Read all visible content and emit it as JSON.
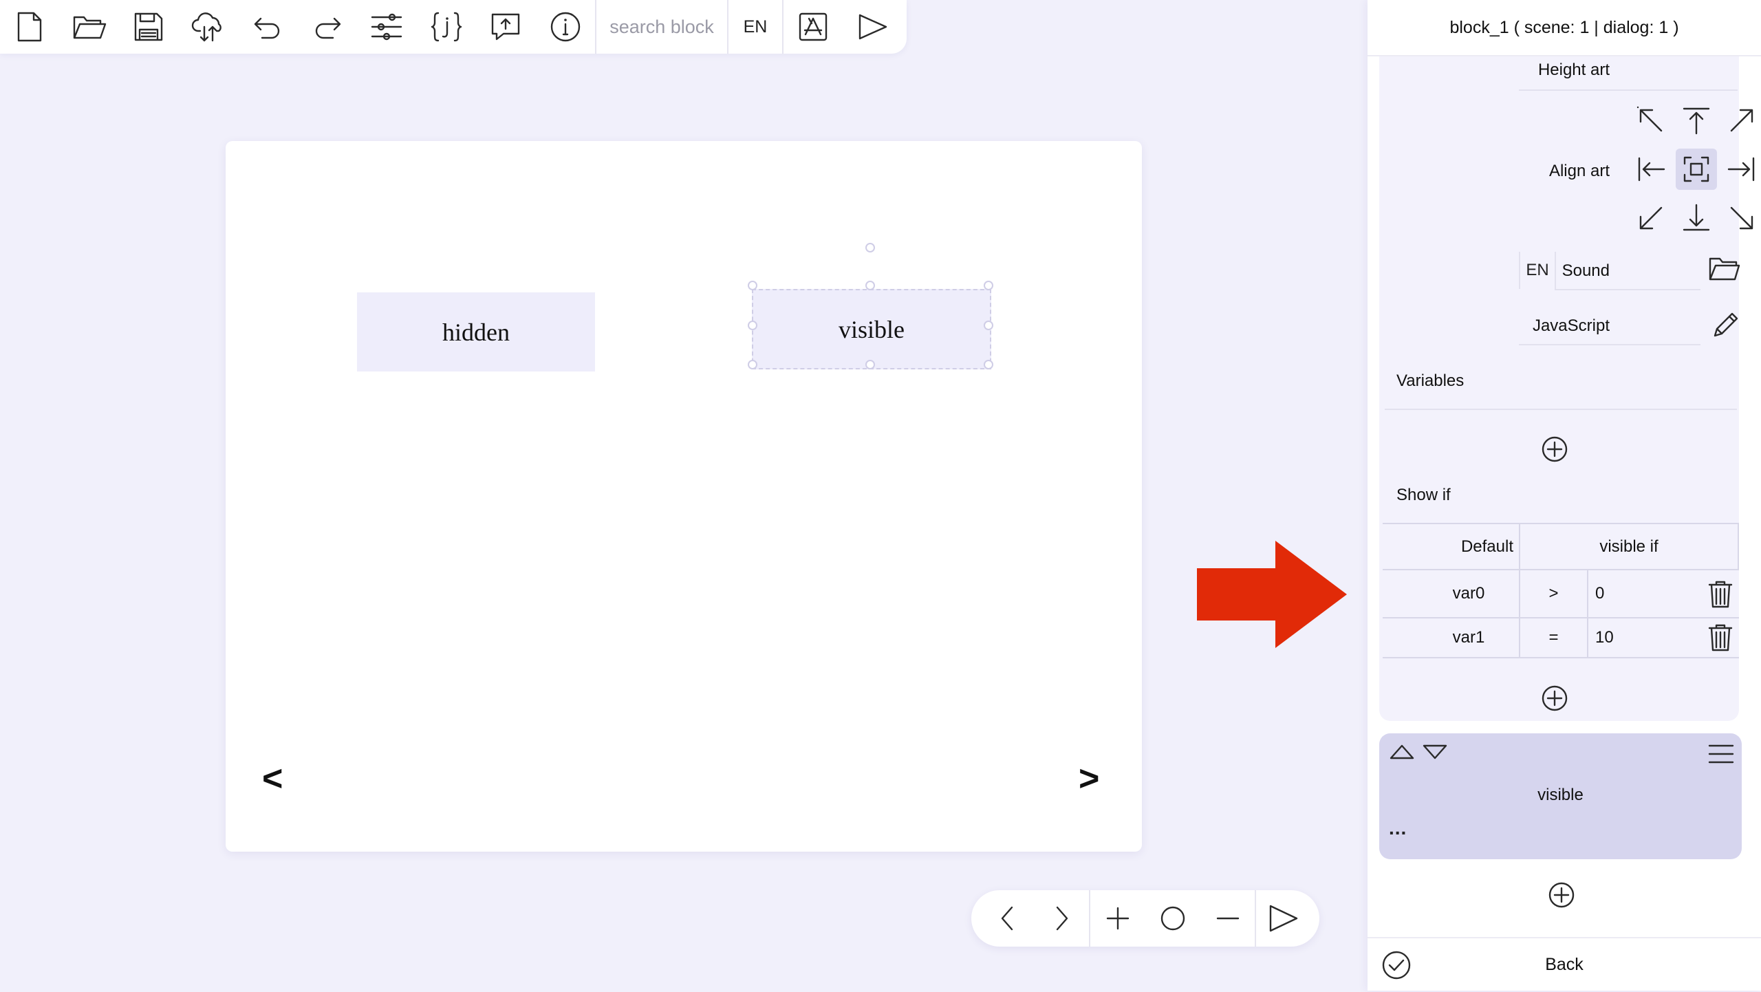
{
  "toolbar": {
    "icons": [
      "new-file-icon",
      "open-folder-icon",
      "save-icon",
      "cloud-sync-icon",
      "undo-icon",
      "redo-icon",
      "settings-sliders-icon",
      "variables-braces-icon",
      "export-message-icon",
      "info-icon"
    ],
    "search_placeholder": "search block",
    "language": "EN",
    "tail_icons": [
      "app-store-icon",
      "play-icon"
    ]
  },
  "canvas": {
    "blocks": [
      {
        "label": "hidden"
      },
      {
        "label": "visible",
        "selected": true
      }
    ],
    "prev_label": "<",
    "next_label": ">"
  },
  "zoom_bar": {
    "icons": [
      "back-icon",
      "forward-icon",
      "zoom-in-icon",
      "zoom-reset-icon",
      "zoom-out-icon",
      "play-icon"
    ]
  },
  "panel": {
    "header": "block_1 ( scene: 1 | dialog: 1 )",
    "height_art_label": "Height art",
    "align_art_label": "Align art",
    "align_active": "center",
    "sound_label": "Sound",
    "sound_lang": "EN",
    "sound_value": "",
    "javascript_label": "JavaScript",
    "javascript_value": "",
    "variables_label": "Variables",
    "show_if_label": "Show if",
    "conditions": {
      "header_left": "Default",
      "header_right": "visible if",
      "rows": [
        {
          "var": "var0",
          "op": ">",
          "value": "0"
        },
        {
          "var": "var1",
          "op": "=",
          "value": "10"
        }
      ]
    },
    "action": {
      "text": "visible",
      "more": "..."
    },
    "footer": {
      "back_label": "Back"
    }
  },
  "colors": {
    "background": "#f1f0fb",
    "block_fill": "#eeedfb",
    "action_card": "#d6d5ee",
    "red_arrow": "#e12a08"
  }
}
